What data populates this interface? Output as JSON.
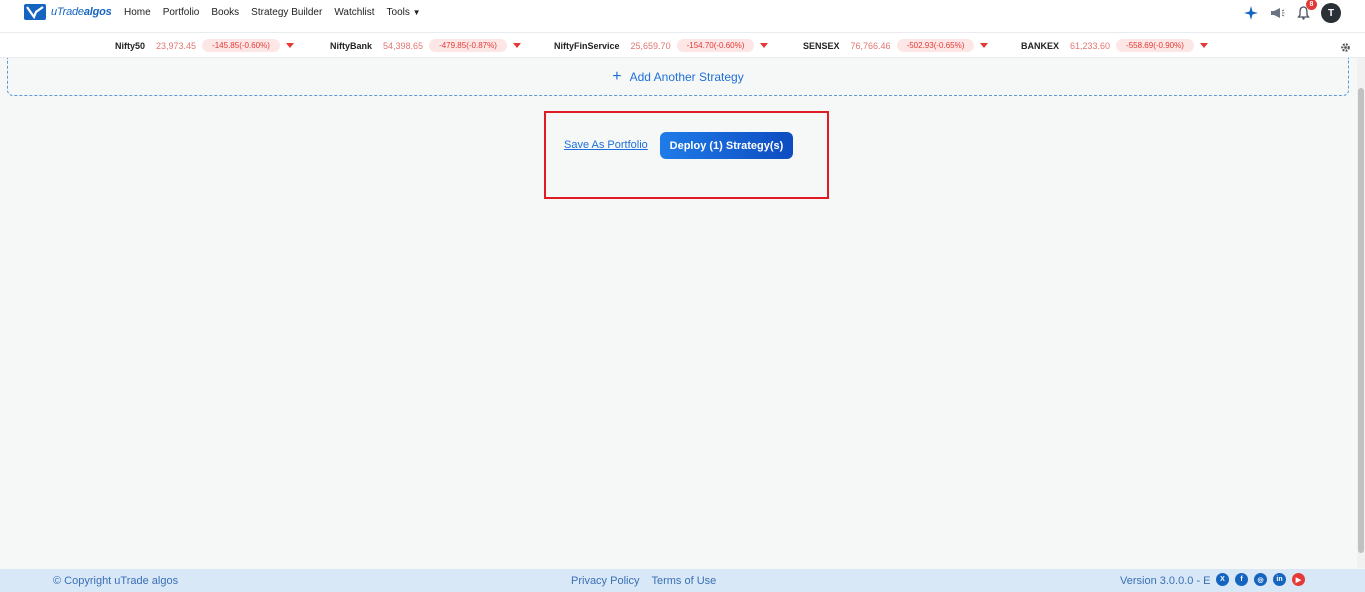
{
  "brand": {
    "name_light": "uTrade",
    "name_bold": "algos"
  },
  "nav": {
    "items": [
      "Home",
      "Portfolio",
      "Books",
      "Strategy Builder",
      "Watchlist",
      "Tools"
    ],
    "notification_count": "8",
    "avatar_initial": "T"
  },
  "ticker": [
    {
      "name": "Nifty50",
      "price": "23,973.45",
      "change": "-145.85(-0.60%)"
    },
    {
      "name": "NiftyBank",
      "price": "54,398.65",
      "change": "-479.85(-0.87%)"
    },
    {
      "name": "NiftyFinService",
      "price": "25,659.70",
      "change": "-154.70(-0.60%)"
    },
    {
      "name": "SENSEX",
      "price": "76,766.46",
      "change": "-502.93(-0.65%)"
    },
    {
      "name": "BANKEX",
      "price": "61,233.60",
      "change": "-558.69(-0.90%)"
    }
  ],
  "builder": {
    "add_strategy_label": "Add Another Strategy",
    "save_portfolio_label": "Save As Portfolio",
    "deploy_label": "Deploy (1) Strategy(s)"
  },
  "footer": {
    "copyright": "© Copyright uTrade algos",
    "privacy": "Privacy Policy",
    "terms": "Terms of Use",
    "version": "Version 3.0.0.0 - E"
  },
  "colors": {
    "accent": "#1e6fd9",
    "negative": "#e53935",
    "highlight": "#e01b24"
  }
}
